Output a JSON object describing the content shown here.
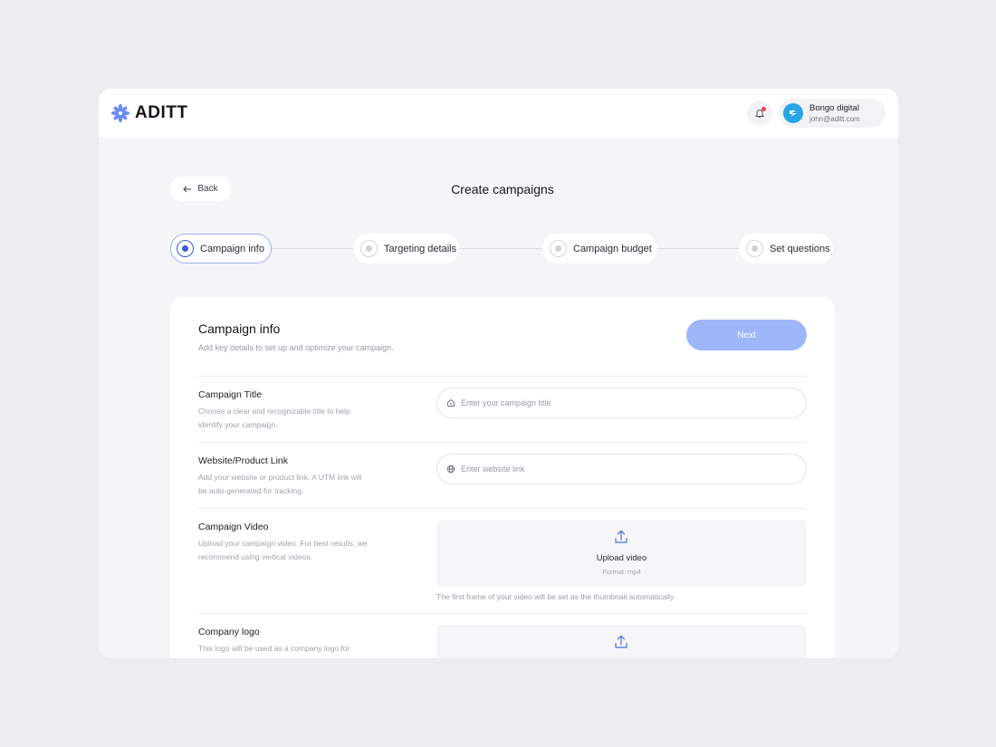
{
  "brand": {
    "name": "ADITT",
    "accent": "#3b5bdb",
    "logo_color": "#6b8cf2"
  },
  "account": {
    "name": "Bongo digital",
    "email": "john@aditt.com",
    "notification_dot_color": "#e5484d"
  },
  "page": {
    "back_label": "Back",
    "title": "Create campaigns"
  },
  "steps": [
    {
      "label": "Campaign info",
      "active": true
    },
    {
      "label": "Targeting details",
      "active": false
    },
    {
      "label": "Campaign budget",
      "active": false
    },
    {
      "label": "Set questions",
      "active": false
    }
  ],
  "card": {
    "title": "Campaign info",
    "subtitle": "Add key details to set up and optimize your campaign.",
    "next_label": "Next"
  },
  "fields": {
    "title": {
      "label": "Campaign Title",
      "description": "Choose a clear and recognizable title to help identify your campaign.",
      "placeholder": "Enter your campaign title",
      "icon": "home-icon"
    },
    "link": {
      "label": "Website/Product Link",
      "description": "Add your website or product link. A UTM link will be auto-generated for tracking.",
      "placeholder": "Enter website link",
      "icon": "globe-icon"
    },
    "video": {
      "label": "Campaign Video",
      "description": "Upload your campaign video. For best results, we recommend using vertical videos.",
      "upload_label": "Upload video",
      "format": "Format: mp4",
      "hint": "The first frame of your video will be set as the thumbnail automatically."
    },
    "logo": {
      "label": "Company logo",
      "description": "This logo will be used as a company logo for"
    }
  }
}
